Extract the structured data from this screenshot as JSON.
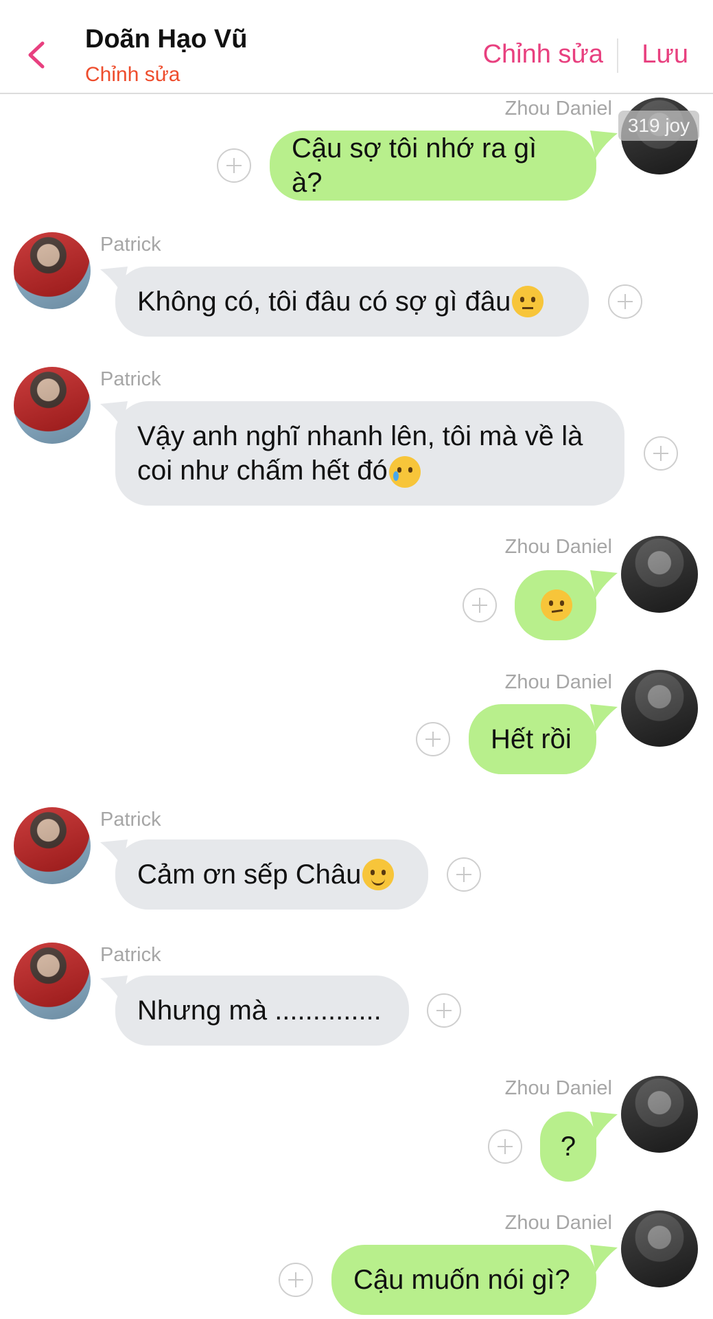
{
  "header": {
    "title": "Doãn Hạo Vũ",
    "subtitle": "Chỉnh sửa",
    "edit_label": "Chỉnh sửa",
    "save_label": "Lưu",
    "accent_color": "#e8407f"
  },
  "watermark": "319 joy",
  "messages": [
    {
      "sender": "Zhou Daniel",
      "text": "Cậu sợ tôi nhớ ra gì à?",
      "side": "right"
    },
    {
      "sender": "Patrick",
      "text": "Không có, tôi đâu có sợ gì đâu",
      "emoji": "neutral-face",
      "side": "left"
    },
    {
      "sender": "Patrick",
      "text": "Vậy anh nghĩ nhanh lên, tôi mà về là coi như chấm hết đó",
      "emoji": "sad-tear-face",
      "side": "left"
    },
    {
      "sender": "Zhou Daniel",
      "text": "",
      "emoji": "unamused-face",
      "side": "right"
    },
    {
      "sender": "Zhou Daniel",
      "text": "Hết rồi",
      "side": "right"
    },
    {
      "sender": "Patrick",
      "text": "Cảm ơn sếp Châu",
      "emoji": "smiling-face",
      "side": "left"
    },
    {
      "sender": "Patrick",
      "text": "Nhưng mà ..............",
      "side": "left"
    },
    {
      "sender": "Zhou Daniel",
      "text": "?",
      "side": "right"
    },
    {
      "sender": "Zhou Daniel",
      "text": "Cậu muốn nói gì?",
      "side": "right"
    }
  ],
  "colors": {
    "outgoing_bubble": "#b8ef8c",
    "incoming_bubble": "#e6e8eb",
    "sender_name": "#a6a6a6",
    "subtitle": "#ee4d2d"
  }
}
